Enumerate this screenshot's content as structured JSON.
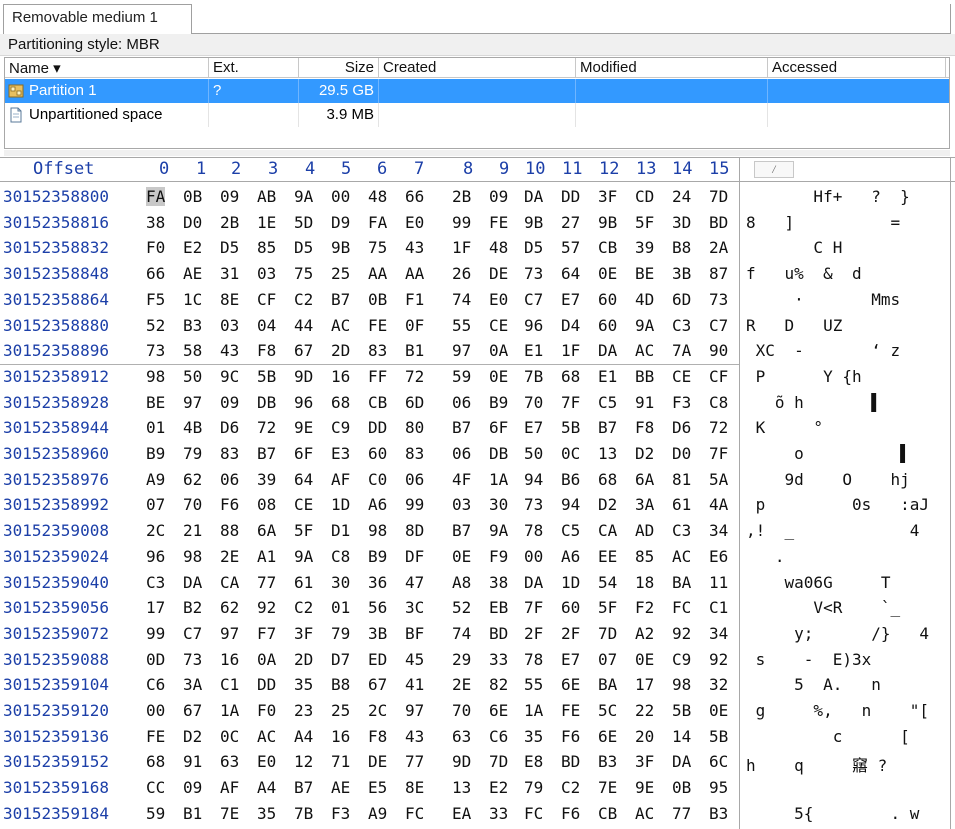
{
  "tab": {
    "label": "Removable medium 1"
  },
  "partition_style": "Partitioning style: MBR",
  "table": {
    "columns": [
      {
        "label": "Name ▾",
        "key": "name"
      },
      {
        "label": "Ext.",
        "key": "ext"
      },
      {
        "label": "Size",
        "key": "size"
      },
      {
        "label": "Created",
        "key": "created"
      },
      {
        "label": "Modified",
        "key": "modified"
      },
      {
        "label": "Accessed",
        "key": "accessed"
      }
    ],
    "rows": [
      {
        "name": "Partition 1",
        "ext": "?",
        "size": "29.5 GB",
        "selected": true,
        "icon": "partition-icon"
      },
      {
        "name": "Unpartitioned space",
        "ext": "",
        "size": "3.9 MB",
        "selected": false,
        "icon": "document-icon"
      }
    ]
  },
  "hex": {
    "offset_label": "Offset",
    "columns": [
      "0",
      "1",
      "2",
      "3",
      "4",
      "5",
      "6",
      "7",
      "8",
      "9",
      "10",
      "11",
      "12",
      "13",
      "14",
      "15"
    ],
    "ascii_button": "⁄",
    "rows": [
      {
        "offset": "30152358800",
        "bytes": [
          "FA",
          "0B",
          "09",
          "AB",
          "9A",
          "00",
          "48",
          "66",
          "2B",
          "09",
          "DA",
          "DD",
          "3F",
          "CD",
          "24",
          "7D"
        ],
        "ascii": "       Hf+   ?  }"
      },
      {
        "offset": "30152358816",
        "bytes": [
          "38",
          "D0",
          "2B",
          "1E",
          "5D",
          "D9",
          "FA",
          "E0",
          "99",
          "FE",
          "9B",
          "27",
          "9B",
          "5F",
          "3D",
          "BD"
        ],
        "ascii": "8   ]          ="
      },
      {
        "offset": "30152358832",
        "bytes": [
          "F0",
          "E2",
          "D5",
          "85",
          "D5",
          "9B",
          "75",
          "43",
          "1F",
          "48",
          "D5",
          "57",
          "CB",
          "39",
          "B8",
          "2A"
        ],
        "ascii": "       C H"
      },
      {
        "offset": "30152358848",
        "bytes": [
          "66",
          "AE",
          "31",
          "03",
          "75",
          "25",
          "AA",
          "AA",
          "26",
          "DE",
          "73",
          "64",
          "0E",
          "BE",
          "3B",
          "87"
        ],
        "ascii": "f   u%  &  d"
      },
      {
        "offset": "30152358864",
        "bytes": [
          "F5",
          "1C",
          "8E",
          "CF",
          "C2",
          "B7",
          "0B",
          "F1",
          "74",
          "E0",
          "C7",
          "E7",
          "60",
          "4D",
          "6D",
          "73"
        ],
        "ascii": "     ·       Mms"
      },
      {
        "offset": "30152358880",
        "bytes": [
          "52",
          "B3",
          "03",
          "04",
          "44",
          "AC",
          "FE",
          "0F",
          "55",
          "CE",
          "96",
          "D4",
          "60",
          "9A",
          "C3",
          "C7"
        ],
        "ascii": "R   D   UZ"
      },
      {
        "offset": "30152358896",
        "bytes": [
          "73",
          "58",
          "43",
          "F8",
          "67",
          "2D",
          "83",
          "B1",
          "97",
          "0A",
          "E1",
          "1F",
          "DA",
          "AC",
          "7A",
          "90"
        ],
        "ascii": " XC  -       ‘ z"
      },
      {
        "offset": "30152358912",
        "bytes": [
          "98",
          "50",
          "9C",
          "5B",
          "9D",
          "16",
          "FF",
          "72",
          "59",
          "0E",
          "7B",
          "68",
          "E1",
          "BB",
          "CE",
          "CF"
        ],
        "ascii": " P      Y {h"
      },
      {
        "offset": "30152358928",
        "bytes": [
          "BE",
          "97",
          "09",
          "DB",
          "96",
          "68",
          "CB",
          "6D",
          "06",
          "B9",
          "70",
          "7F",
          "C5",
          "91",
          "F3",
          "C8"
        ],
        "ascii": "   õ h       ▌"
      },
      {
        "offset": "30152358944",
        "bytes": [
          "01",
          "4B",
          "D6",
          "72",
          "9E",
          "C9",
          "DD",
          "80",
          "B7",
          "6F",
          "E7",
          "5B",
          "B7",
          "F8",
          "D6",
          "72"
        ],
        "ascii": " K     °"
      },
      {
        "offset": "30152358960",
        "bytes": [
          "B9",
          "79",
          "83",
          "B7",
          "6F",
          "E3",
          "60",
          "83",
          "06",
          "DB",
          "50",
          "0C",
          "13",
          "D2",
          "D0",
          "7F"
        ],
        "ascii": "     o          ▌"
      },
      {
        "offset": "30152358976",
        "bytes": [
          "A9",
          "62",
          "06",
          "39",
          "64",
          "AF",
          "C0",
          "06",
          "4F",
          "1A",
          "94",
          "B6",
          "68",
          "6A",
          "81",
          "5A"
        ],
        "ascii": "    9d    O    hj"
      },
      {
        "offset": "30152358992",
        "bytes": [
          "07",
          "70",
          "F6",
          "08",
          "CE",
          "1D",
          "A6",
          "99",
          "03",
          "30",
          "73",
          "94",
          "D2",
          "3A",
          "61",
          "4A"
        ],
        "ascii": " p         0s   :aJ"
      },
      {
        "offset": "30152359008",
        "bytes": [
          "2C",
          "21",
          "88",
          "6A",
          "5F",
          "D1",
          "98",
          "8D",
          "B7",
          "9A",
          "78",
          "C5",
          "CA",
          "AD",
          "C3",
          "34"
        ],
        "ascii": ",!  _            4"
      },
      {
        "offset": "30152359024",
        "bytes": [
          "96",
          "98",
          "2E",
          "A1",
          "9A",
          "C8",
          "B9",
          "DF",
          "0E",
          "F9",
          "00",
          "A6",
          "EE",
          "85",
          "AC",
          "E6"
        ],
        "ascii": "   ."
      },
      {
        "offset": "30152359040",
        "bytes": [
          "C3",
          "DA",
          "CA",
          "77",
          "61",
          "30",
          "36",
          "47",
          "A8",
          "38",
          "DA",
          "1D",
          "54",
          "18",
          "BA",
          "11"
        ],
        "ascii": "    wa06G     T"
      },
      {
        "offset": "30152359056",
        "bytes": [
          "17",
          "B2",
          "62",
          "92",
          "C2",
          "01",
          "56",
          "3C",
          "52",
          "EB",
          "7F",
          "60",
          "5F",
          "F2",
          "FC",
          "C1"
        ],
        "ascii": "       V<R    `_"
      },
      {
        "offset": "30152359072",
        "bytes": [
          "99",
          "C7",
          "97",
          "F7",
          "3F",
          "79",
          "3B",
          "BF",
          "74",
          "BD",
          "2F",
          "2F",
          "7D",
          "A2",
          "92",
          "34"
        ],
        "ascii": "     y;      /}   4"
      },
      {
        "offset": "30152359088",
        "bytes": [
          "0D",
          "73",
          "16",
          "0A",
          "2D",
          "D7",
          "ED",
          "45",
          "29",
          "33",
          "78",
          "E7",
          "07",
          "0E",
          "C9",
          "92"
        ],
        "ascii": " s    -  E)3x"
      },
      {
        "offset": "30152359104",
        "bytes": [
          "C6",
          "3A",
          "C1",
          "DD",
          "35",
          "B8",
          "67",
          "41",
          "2E",
          "82",
          "55",
          "6E",
          "BA",
          "17",
          "98",
          "32"
        ],
        "ascii": "     5  A.   n"
      },
      {
        "offset": "30152359120",
        "bytes": [
          "00",
          "67",
          "1A",
          "F0",
          "23",
          "25",
          "2C",
          "97",
          "70",
          "6E",
          "1A",
          "FE",
          "5C",
          "22",
          "5B",
          "0E"
        ],
        "ascii": " g     %,   n    \"["
      },
      {
        "offset": "30152359136",
        "bytes": [
          "FE",
          "D2",
          "0C",
          "AC",
          "A4",
          "16",
          "F8",
          "43",
          "63",
          "C6",
          "35",
          "F6",
          "6E",
          "20",
          "14",
          "5B"
        ],
        "ascii": "         c      ["
      },
      {
        "offset": "30152359152",
        "bytes": [
          "68",
          "91",
          "63",
          "E0",
          "12",
          "71",
          "DE",
          "77",
          "9D",
          "7D",
          "E8",
          "BD",
          "B3",
          "3F",
          "DA",
          "6C"
        ],
        "ascii": "h    q     窹 ?"
      },
      {
        "offset": "30152359168",
        "bytes": [
          "CC",
          "09",
          "AF",
          "A4",
          "B7",
          "AE",
          "E5",
          "8E",
          "13",
          "E2",
          "79",
          "C2",
          "7E",
          "9E",
          "0B",
          "95"
        ],
        "ascii": ""
      },
      {
        "offset": "30152359184",
        "bytes": [
          "59",
          "B1",
          "7E",
          "35",
          "7B",
          "F3",
          "A9",
          "FC",
          "EA",
          "33",
          "FC",
          "F6",
          "CB",
          "AC",
          "77",
          "B3"
        ],
        "ascii": "     5{        . w"
      }
    ]
  }
}
